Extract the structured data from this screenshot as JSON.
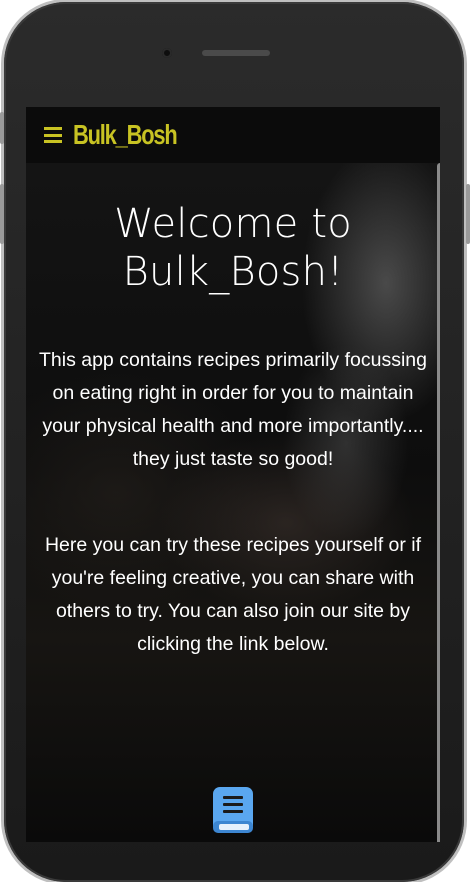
{
  "navbar": {
    "brand": "Bulk_Bosh",
    "menu_icon": "hamburger-menu-icon",
    "accent_color": "#c8c323"
  },
  "hero": {
    "title": "Welcome to Bulk_Bosh!",
    "intro": "This app contains recipes primarily focussing on eating right in order for you to maintain your physical health and more importantly.... they just taste so good!",
    "join_text": "Here you can try these recipes yourself or if you're feeling creative, you can share with others to try. You can also join our site by clicking the link below.",
    "link_icon": "book-icon",
    "link_icon_color": "#5aa7f0"
  }
}
